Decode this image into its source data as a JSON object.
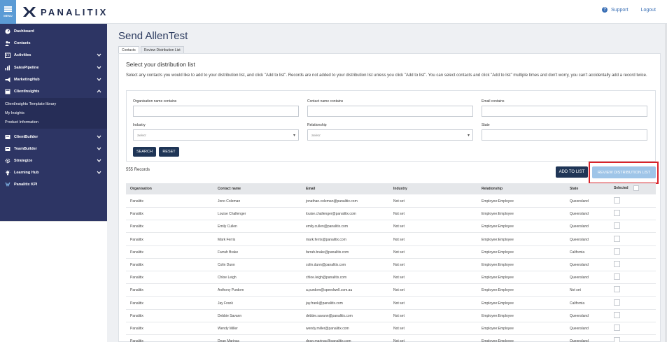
{
  "topbar": {
    "menu_label": "MENU",
    "brand": "PANALITIX",
    "support": "Support",
    "logout": "Logout",
    "help_glyph": "?"
  },
  "sidebar": {
    "items": [
      {
        "label": "Dashboard",
        "icon": "dashboard-icon",
        "expandable": false
      },
      {
        "label": "Contacts",
        "icon": "contacts-icon",
        "expandable": false
      },
      {
        "label": "Activities",
        "icon": "activities-icon",
        "expandable": true
      },
      {
        "label": "SalesPipeline",
        "icon": "pipeline-icon",
        "expandable": true
      },
      {
        "label": "MarketingHub",
        "icon": "megaphone-icon",
        "expandable": true
      },
      {
        "label": "ClientInsights",
        "icon": "insights-icon",
        "expandable": true,
        "expanded": true
      },
      {
        "label": "ClientBuilder",
        "icon": "builder-icon",
        "expandable": true
      },
      {
        "label": "TeamBuilder",
        "icon": "team-icon",
        "expandable": true
      },
      {
        "label": "Strategize",
        "icon": "gear-icon",
        "expandable": true
      },
      {
        "label": "Learning Hub",
        "icon": "lightbulb-icon",
        "expandable": true
      },
      {
        "label": "Panalitix KPI",
        "icon": "kpi-icon",
        "expandable": false
      }
    ],
    "subitems": [
      "ClientInsights Template library",
      "My Insights",
      "Product Information"
    ]
  },
  "page": {
    "title": "Send AllenTest",
    "tabs": [
      "Contacts",
      "Review Distribution List"
    ],
    "section_title": "Select your distribution list",
    "intro": "Select any contacts you would like to add to your distribution list, and click \"Add to list\". Records are not added to your distribution list unless you click \"Add to list\". You can select contacts and click \"Add to list\" multiple times and don't worry, you can't accidentally add a record twice."
  },
  "filters": {
    "org_label": "Organisation name contains",
    "contact_label": "Contact name contains",
    "email_label": "Email contains",
    "industry_label": "Industry",
    "relationship_label": "Relationship",
    "state_label": "State",
    "industry_placeholder": "Select",
    "relationship_placeholder": "Select",
    "search_button": "SEARCH",
    "reset_button": "RESET"
  },
  "list": {
    "records": "555 Records",
    "add_button": "ADD TO LIST",
    "review_button": "REVIEW DISTRIBUTION LIST",
    "columns": [
      "Organisation",
      "Contact name",
      "Email",
      "Industry",
      "Relationship",
      "State",
      "Selected"
    ],
    "rows": [
      [
        "Panalitix",
        "Jono Coleman",
        "jonathan.coleman@panalitix.com",
        "Not set",
        "Employee:Employee",
        "Queensland"
      ],
      [
        "Panalitix",
        "Louise Challenger",
        "louise.challenger@panalitix.com",
        "Not set",
        "Employee:Employee",
        "Queensland"
      ],
      [
        "Panalitix",
        "Emily Cullen",
        "emily.cullen@panalitix.com",
        "Not set",
        "Employee:Employee",
        "Queensland"
      ],
      [
        "Panalitix",
        "Mark Ferris",
        "mark.ferris@panalitix.com",
        "Not set",
        "Employee:Employee",
        "Queensland"
      ],
      [
        "Panalitix",
        "Farrah Brake",
        "farrah.brake@panalitix.com",
        "Not set",
        "Employee:Employee",
        "California"
      ],
      [
        "Panalitix",
        "Colin Dunn",
        "colin.dunn@panalitix.com",
        "Not set",
        "Employee:Employee",
        "Queensland"
      ],
      [
        "Panalitix",
        "Chloe Leigh",
        "chloe.leigh@panalitix.com",
        "Not set",
        "Employee:Employee",
        "Queensland"
      ],
      [
        "Panalitix",
        "Anthony Purdom",
        "a.purdom@speedwell.com.au",
        "Not set",
        "Employee:Employee",
        "Not set"
      ],
      [
        "Panalitix",
        "Jay Frank",
        "jay.frank@panalitix.com",
        "Not set",
        "Employee:Employee",
        "California"
      ],
      [
        "Panalitix",
        "Debbie Savann",
        "debbie.savann@panalitix.com",
        "Not set",
        "Employee:Employee",
        "Queensland"
      ],
      [
        "Panalitix",
        "Wendy Miller",
        "wendy.miller@panalitix.com",
        "Not set",
        "Employee:Employee",
        "Queensland"
      ],
      [
        "Panalitix",
        "Dean Marinac",
        "dean.marinac@panalitix.com",
        "Not set",
        "Employee:Employee",
        "Queensland"
      ]
    ]
  },
  "colors": {
    "sidebar": "#2d3564",
    "accent": "#5b9bd5",
    "primary_button": "#1f3556",
    "highlight": "#d9232a"
  }
}
